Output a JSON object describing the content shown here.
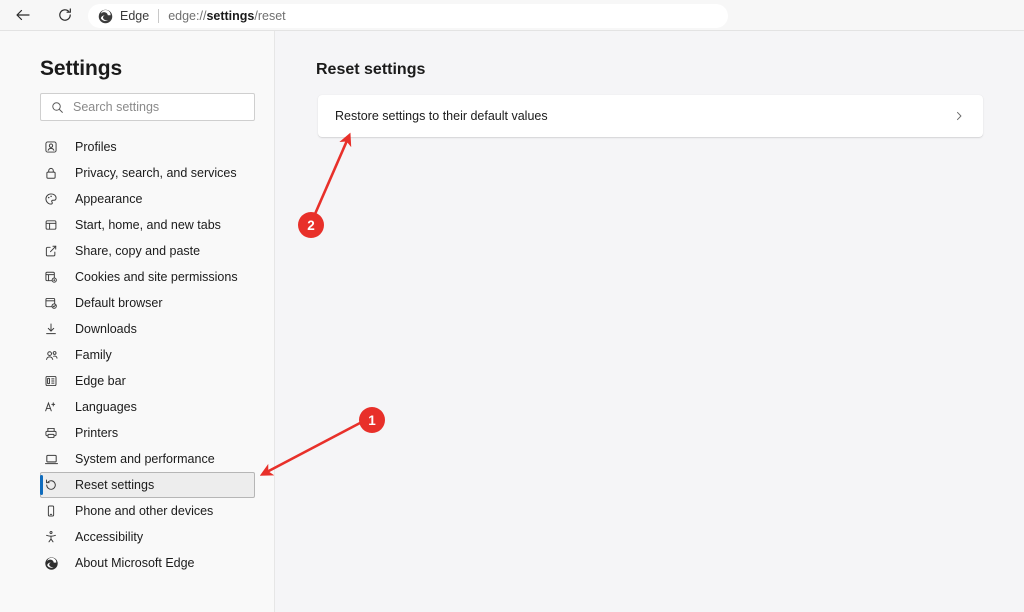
{
  "browser": {
    "back_icon": "back-arrow-icon",
    "reload_icon": "reload-icon",
    "brand": "Edge",
    "url_prefix": "edge://",
    "url_bold": "settings",
    "url_suffix": "/reset",
    "url_full": "edge://settings/reset"
  },
  "sidebar": {
    "title": "Settings",
    "search": {
      "placeholder": "Search settings",
      "value": "",
      "icon": "search-icon"
    },
    "items": [
      {
        "label": "Profiles",
        "icon": "profile-icon",
        "selected": false
      },
      {
        "label": "Privacy, search, and services",
        "icon": "lock-icon",
        "selected": false
      },
      {
        "label": "Appearance",
        "icon": "palette-icon",
        "selected": false
      },
      {
        "label": "Start, home, and new tabs",
        "icon": "window-icon",
        "selected": false
      },
      {
        "label": "Share, copy and paste",
        "icon": "share-icon",
        "selected": false
      },
      {
        "label": "Cookies and site permissions",
        "icon": "cookie-icon",
        "selected": false
      },
      {
        "label": "Default browser",
        "icon": "browser-check-icon",
        "selected": false
      },
      {
        "label": "Downloads",
        "icon": "download-icon",
        "selected": false
      },
      {
        "label": "Family",
        "icon": "family-icon",
        "selected": false
      },
      {
        "label": "Edge bar",
        "icon": "edge-bar-icon",
        "selected": false
      },
      {
        "label": "Languages",
        "icon": "language-icon",
        "selected": false
      },
      {
        "label": "Printers",
        "icon": "printer-icon",
        "selected": false
      },
      {
        "label": "System and performance",
        "icon": "laptop-icon",
        "selected": false
      },
      {
        "label": "Reset settings",
        "icon": "reset-icon",
        "selected": true
      },
      {
        "label": "Phone and other devices",
        "icon": "phone-icon",
        "selected": false
      },
      {
        "label": "Accessibility",
        "icon": "accessibility-icon",
        "selected": false
      },
      {
        "label": "About Microsoft Edge",
        "icon": "edge-logo-icon",
        "selected": false
      }
    ]
  },
  "main": {
    "title": "Reset settings",
    "rows": [
      {
        "label": "Restore settings to their default values",
        "chevron": "chevron-right-icon"
      }
    ]
  },
  "annotations": {
    "accent_color": "#e8302a",
    "markers": [
      {
        "number": "1",
        "target": "sidebar-item-reset-settings"
      },
      {
        "number": "2",
        "target": "restore-defaults-row"
      }
    ]
  },
  "colors": {
    "accent_blue": "#0f6cbd",
    "annotation_red": "#e8302a",
    "sidebar_bg": "#f9f9f9",
    "content_bg": "#f5f5f7",
    "card_bg": "#ffffff"
  }
}
